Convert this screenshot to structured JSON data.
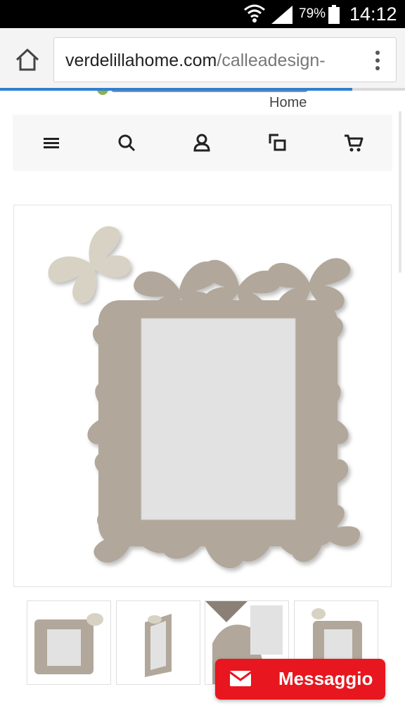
{
  "status_bar": {
    "battery_percent": "79%",
    "time": "14:12",
    "icons": [
      "wifi-icon",
      "signal-icon",
      "battery-icon"
    ]
  },
  "browser": {
    "url_host": "verdelillahome.com",
    "url_path": "/calleadesign-",
    "load_progress": 0.87,
    "icons": [
      "home-icon",
      "menu-dots-icon"
    ]
  },
  "site": {
    "logo_sub": "Home",
    "toolbar_icons": [
      "menu-icon",
      "search-icon",
      "account-icon",
      "compare-icon",
      "cart-icon"
    ]
  },
  "product": {
    "thumbnail_count": 4
  },
  "contact": {
    "message_label": "Messaggio",
    "icon": "envelope-icon"
  },
  "colors": {
    "message_button": "#e8161e",
    "butterfly_taupe": "#b2a79b",
    "butterfly_cream": "#d8d2c4",
    "progress_blue": "#2f7fd1"
  }
}
